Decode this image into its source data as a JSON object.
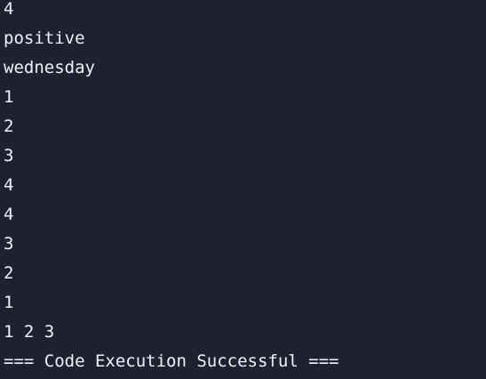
{
  "console": {
    "lines": [
      "4",
      "positive",
      "wednesday",
      "1",
      "2",
      "3",
      "4",
      "4",
      "3",
      "2",
      "1",
      "1 2 3",
      "=== Code Execution Successful ==="
    ]
  },
  "colors": {
    "background": "#1e2130",
    "text": "#f1f3f8"
  }
}
